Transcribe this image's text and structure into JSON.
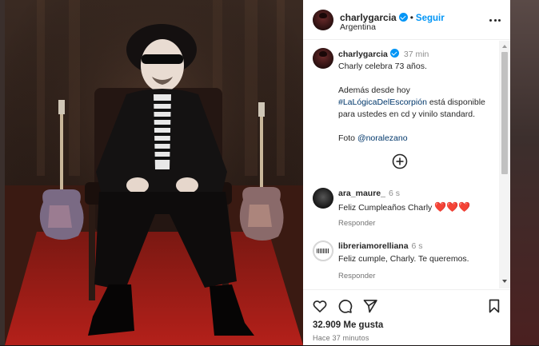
{
  "post": {
    "author": "charlygarcia",
    "follow_label": "Seguir",
    "location": "Argentina"
  },
  "caption": {
    "username": "charlygarcia",
    "time": "37 min",
    "line1": "Charly celebra 73 años.",
    "line2": "Además desde hoy",
    "hashtag": "#LaLógicaDelEscorpión",
    "line3_after_hashtag": " está disponible",
    "line4": "para ustedes en cd y vinilo standard.",
    "photo_prefix": "Foto ",
    "mention": "@noralezano"
  },
  "comments": [
    {
      "username": "ara_maure_",
      "time": "6 s",
      "text": "Feliz Cumpleaños Charly",
      "emoji": "❤️❤️❤️",
      "reply_label": "Responder"
    },
    {
      "username": "libreriamorelliana",
      "time": "6 s",
      "text": "Feliz cumple, Charly. Te queremos.",
      "emoji": "",
      "reply_label": "Responder"
    }
  ],
  "engagement": {
    "likes": "32.909 Me gusta",
    "time_ago": "Hace 37 minutos"
  },
  "icons": {
    "verified": "verified-badge-icon",
    "more": "more-options-icon",
    "load_more": "plus-circle-icon",
    "like": "heart-icon",
    "comment": "comment-bubble-icon",
    "share": "paper-plane-icon",
    "save": "bookmark-icon"
  },
  "colors": {
    "accent": "#0095f6",
    "link": "#00376b",
    "text": "#262626",
    "muted": "#737373",
    "heart_red": "#e0242b"
  }
}
